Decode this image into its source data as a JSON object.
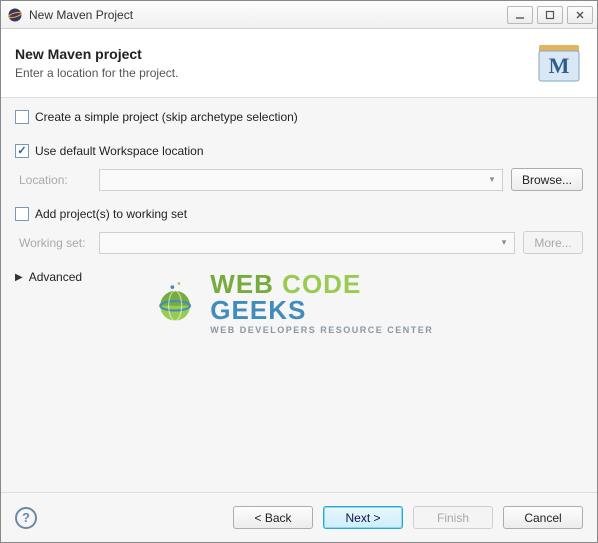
{
  "titlebar": {
    "title": "New Maven Project"
  },
  "header": {
    "heading": "New Maven project",
    "subheading": "Enter a location for the project."
  },
  "options": {
    "simple_project": {
      "label": "Create a simple project (skip archetype selection)",
      "checked": false
    },
    "default_workspace": {
      "label": "Use default Workspace location",
      "checked": true
    },
    "location": {
      "label": "Location:",
      "value": "",
      "browse_label": "Browse...",
      "enabled": false
    },
    "working_set_chk": {
      "label": "Add project(s) to working set",
      "checked": false
    },
    "working_set": {
      "label": "Working set:",
      "value": "",
      "more_label": "More...",
      "enabled": false
    },
    "advanced_label": "Advanced"
  },
  "watermark": {
    "main_a": "WEB ",
    "main_b": "CODE ",
    "main_c": "GEEKS",
    "sub": "WEB DEVELOPERS RESOURCE CENTER"
  },
  "footer": {
    "back": "< Back",
    "next": "Next >",
    "finish": "Finish",
    "cancel": "Cancel"
  }
}
